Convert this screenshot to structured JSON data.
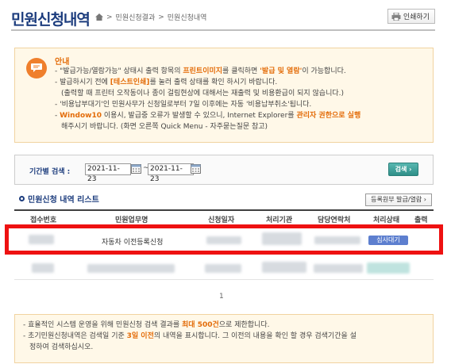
{
  "header": {
    "title": "민원신청내역",
    "breadcrumb": [
      "민원신청결과",
      "민원신청내역"
    ],
    "breadcrumb_sep": ">",
    "print_label": "인쇄하기"
  },
  "notice": {
    "title": "안내",
    "line1": {
      "a": "- \"발급가능/열람가능\" 상태시 출력 항목의 ",
      "b": "프린트이미지",
      "c": "를 클릭하면 ",
      "d": "'발급 및 열람'",
      "e": "이 가능합니다."
    },
    "line2": {
      "a": "- 발급하시기 전에 ",
      "b": "[테스트인쇄]",
      "c": "를 눌러 출력 상태를 확인 하시기 바랍니다."
    },
    "line3": "(출력할 때 프린터 오작동이나 종이 걸림현상에 대해서는 재출력 및 비용환급이 되지 않습니다.)",
    "line4": "- '비용납부대기'인 민원사무가 신청일로부터 7일 이후에는 자동 '비용납부취소'됩니다.",
    "line5": {
      "a": "- ",
      "b": "Window10",
      "c": " 이용시, 발급중 오류가 발생할 수 있으니, Internet Explorer를 ",
      "d": "관리자 권한으로 실행",
      "e": ""
    },
    "line6": "해주시기 바랍니다. (화면 오른쪽 Quick Menu - 자주묻는질문 참고)"
  },
  "search": {
    "label": "기간별 검색 :",
    "date_from": "2021-11-23",
    "date_to": "2021-11-23",
    "tilde": "~",
    "button_label": "검색 ›"
  },
  "list": {
    "title": "민원신청 내역 리스트",
    "action_button": "등록원부 발급/열람 ›",
    "columns": [
      "접수번호",
      "민원업무명",
      "신청일자",
      "처리기관",
      "담당연락처",
      "처리상태",
      "출력"
    ],
    "rows": [
      {
        "task_name": "자동차 이전등록신청",
        "status": "심사대기"
      }
    ],
    "page": "1"
  },
  "bottom_notice": {
    "line1": {
      "a": "- 효율적인 시스템 운영을 위해 민원신청 검색 결과를 ",
      "b": "최대 500건",
      "c": "으로 제한합니다."
    },
    "line2": {
      "a": "- 초기민원신청내역은 검색일 기준 ",
      "b": "3일 이전",
      "c": "의 내역을 표시합니다. 그 이전의 내용을 확인 할 경우 검색기간을 설"
    },
    "line3": "정하여 검색하십시오."
  },
  "colors": {
    "title": "#1c3c7d",
    "accent_orange": "#e36c09",
    "highlight_red": "#ee1111",
    "status_blue": "#5d7fcf",
    "search_button": "#2f8f88"
  }
}
